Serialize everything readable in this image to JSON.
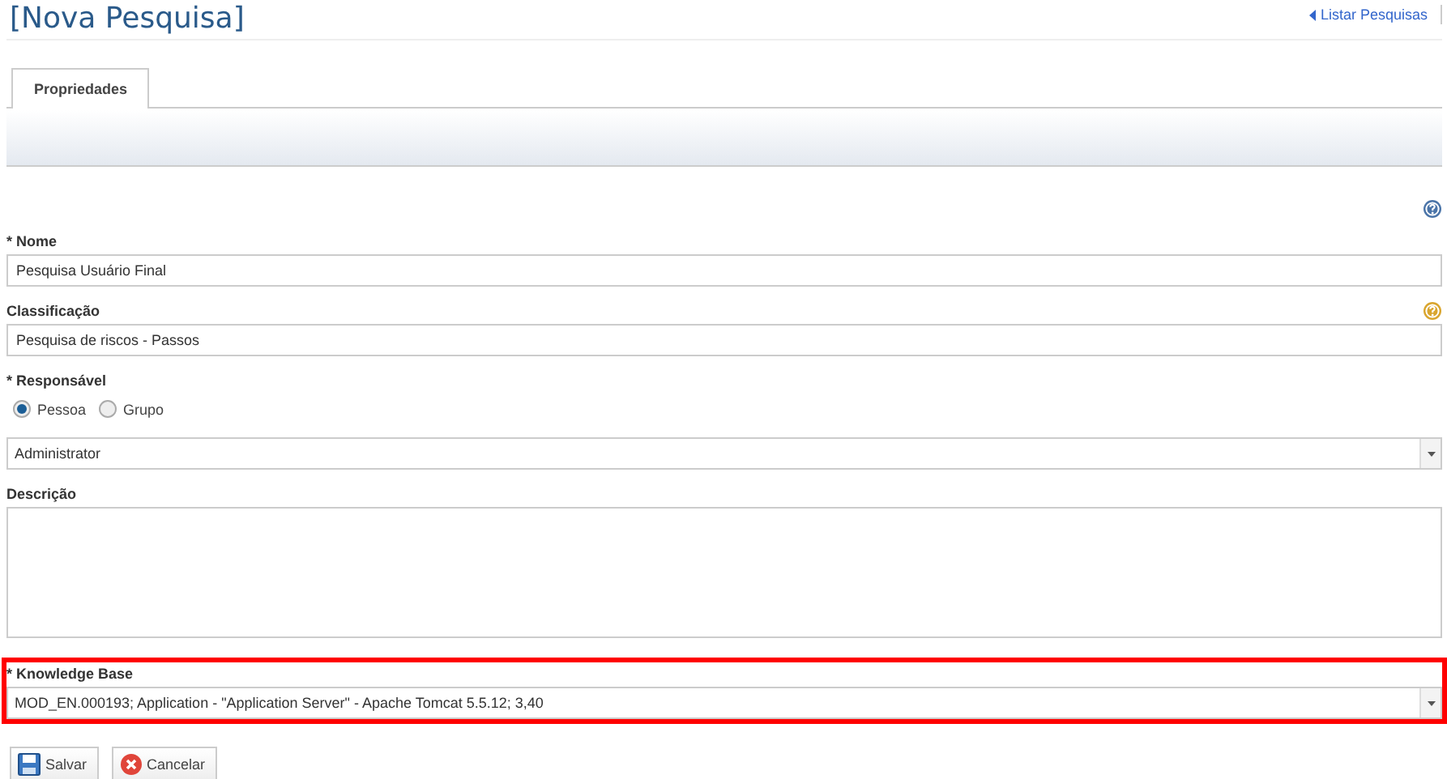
{
  "page": {
    "title": "[Nova Pesquisa]",
    "back_link": "Listar Pesquisas",
    "help": true
  },
  "tabs": [
    {
      "label": "Propriedades",
      "selected": true
    }
  ],
  "fields": [
    {
      "kind": "text",
      "label": "* Nome",
      "value": "Pesquisa Usuário Final",
      "help": false,
      "highlighted": false
    },
    {
      "kind": "text",
      "label": "Classificação",
      "value": "Pesquisa de riscos - Passos",
      "help": true,
      "highlighted": false
    },
    {
      "kind": "radio",
      "label": "* Responsável",
      "options": [
        {
          "label": "Pessoa",
          "selected": true
        },
        {
          "label": "Grupo",
          "selected": false
        }
      ]
    },
    {
      "kind": "select",
      "value": "Administrator",
      "highlighted": false
    },
    {
      "kind": "textarea",
      "label": "Descrição",
      "highlighted": false
    },
    {
      "kind": "select",
      "label": "* Knowledge Base",
      "value": "MOD_EN.000193; Application - \"Application Server\" - Apache Tomcat 5.5.12; 3,40",
      "highlighted": true
    }
  ],
  "buttons": [
    {
      "kind": "save",
      "label": "Salvar"
    },
    {
      "kind": "cancel",
      "label": "Cancelar"
    }
  ]
}
